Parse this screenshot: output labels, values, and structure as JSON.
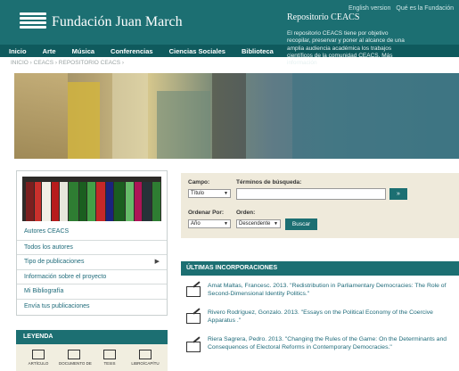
{
  "header": {
    "utility_links": [
      "English version",
      "Qué es la Fundación"
    ],
    "logo_text": "Fundación Juan March"
  },
  "nav": {
    "items": [
      "Inicio",
      "Arte",
      "Música",
      "Conferencias",
      "Ciencias Sociales",
      "Biblioteca"
    ]
  },
  "breadcrumb": "INICIO › CEACS › REPOSITORIO CEACS ›",
  "hero": {
    "title": "Repositorio CEACS",
    "text": "El repositorio CEACS tiene por objetivo recopilar, preservar y poner al alcance de una amplia audiencia académica los trabajos científicos de la comunidad CEACS. Más información"
  },
  "sidebar": {
    "items": [
      {
        "label": "Autores CEACS",
        "has_arrow": false
      },
      {
        "label": "Todos los autores",
        "has_arrow": false
      },
      {
        "label": "Tipo de publicaciones",
        "has_arrow": true
      },
      {
        "label": "Información sobre el proyecto",
        "has_arrow": false
      },
      {
        "label": "Mi Bibliografía",
        "has_arrow": false
      },
      {
        "label": "Envía tus publicaciones",
        "has_arrow": false
      }
    ],
    "arrow_glyph": "▶"
  },
  "legend": {
    "title": "LEYENDA",
    "items": [
      "ARTÍCULO",
      "DOCUMENTO DE",
      "TESIS",
      "LIBRO/CAPÍTU"
    ]
  },
  "search": {
    "campo_label": "Campo:",
    "campo_value": "Título",
    "terms_label": "Términos de búsqueda:",
    "terms_value": "",
    "go_label": "»",
    "order_by_label": "Ordenar Por:",
    "order_by_value": "Año",
    "order_label": "Orden:",
    "order_value": "Descendente",
    "submit_label": "Buscar"
  },
  "latest": {
    "title": "ÚLTIMAS INCORPORACIONES",
    "entries": [
      "Amat Maltas, Francesc. 2013. \"Redistribution in Parliamentary Democracies: The Role of Second-Dimensional Identity Politics.\"",
      "Rivero Rodríguez, Gonzalo. 2013. \"Essays on the Political Economy of the Coercive Apparatus .\"",
      "Riera Sagrera, Pedro. 2013. \"Changing the Rules of the Game: On the Determinants and Consequences of Electoral Reforms in Contemporary Democracies.\""
    ]
  },
  "colors": {
    "header_teal": "#1c6f72",
    "nav_teal": "#0f5a5d",
    "link_blue": "#1f6b7a",
    "search_bg": "#efeadb"
  }
}
